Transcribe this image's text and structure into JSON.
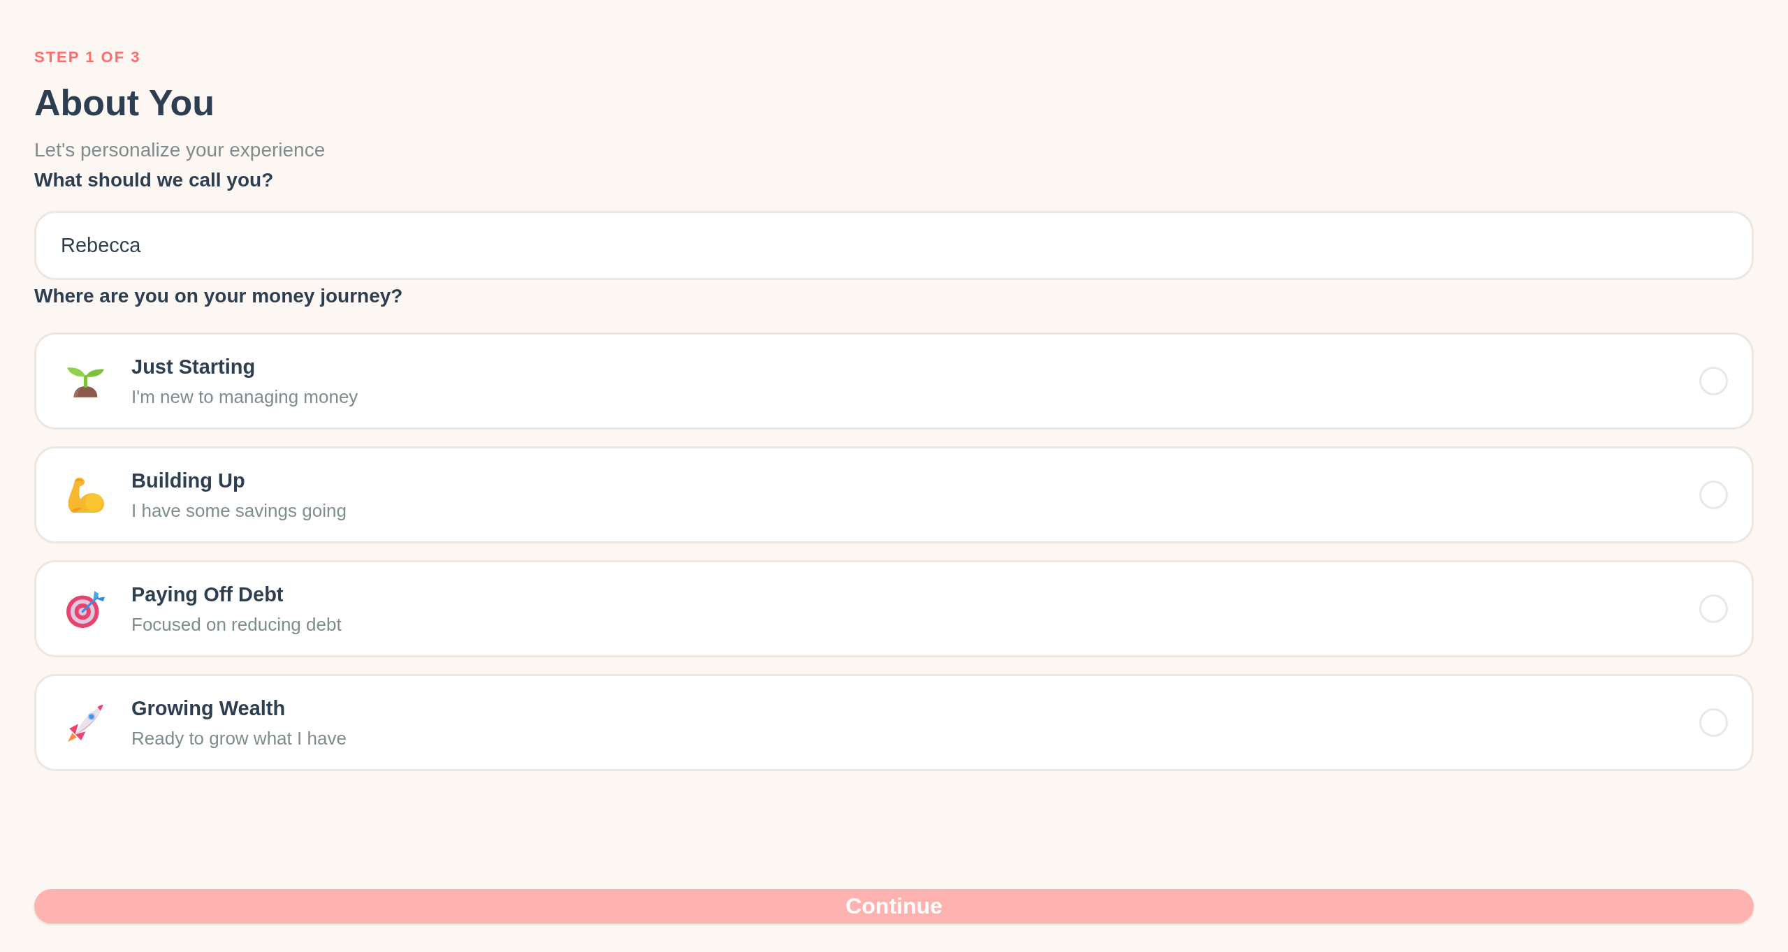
{
  "step_label": "STEP 1 OF 3",
  "title": "About You",
  "subtitle": "Let's personalize your experience",
  "name_field": {
    "label": "What should we call you?",
    "value": "Rebecca"
  },
  "journey": {
    "label": "Where are you on your money journey?",
    "options": [
      {
        "title": "Just Starting",
        "description": "I'm new to managing money",
        "selected": false
      },
      {
        "title": "Building Up",
        "description": "I have some savings going",
        "selected": false
      },
      {
        "title": "Paying Off Debt",
        "description": "Focused on reducing debt",
        "selected": false
      },
      {
        "title": "Growing Wealth",
        "description": "Ready to grow what I have",
        "selected": false
      }
    ]
  },
  "continue_button": {
    "label": "Continue",
    "disabled": true
  }
}
